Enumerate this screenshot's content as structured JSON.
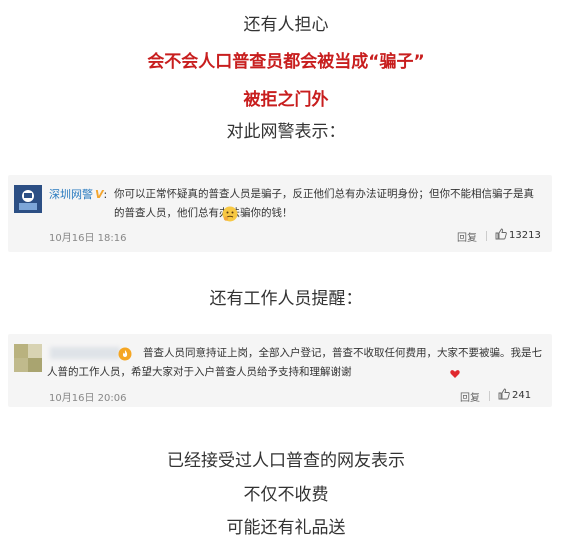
{
  "intro": {
    "line1": "还有人担心",
    "line2": "会不会人口普查员都会被当成“骗子”",
    "line3": "被拒之门外",
    "line4": "对此网警表示："
  },
  "comment1": {
    "user": "深圳网警",
    "text": "你可以正常怀疑真的普查人员是骗子，反正他们总有办法证明身份；但你不能相信骗子是真的普查人员，他们总有办法骗你的钱！",
    "time": "10月16日 18:16",
    "reply_label": "回复",
    "likes": "13213",
    "emoji_icon": "thinking-face-icon"
  },
  "middle": {
    "line": "还有工作人员提醒："
  },
  "comment2": {
    "text": "普查人员同意持证上岗，全部入户登记，普查不收取任何费用，大家不要被骗。我是七人普的工作人员，希望大家对于入户普查人员给予支持和理解谢谢",
    "time": "10月16日 20:06",
    "reply_label": "回复",
    "likes": "241",
    "emoji_icon": "heart-icon"
  },
  "outro": {
    "line1": "已经接受过人口普查的网友表示",
    "line2": "不仅不收费",
    "line3": "可能还有礼品送"
  },
  "colors": {
    "red": "#c81e1e",
    "link": "#2a7bc0",
    "card_bg": "#f5f5f5"
  }
}
